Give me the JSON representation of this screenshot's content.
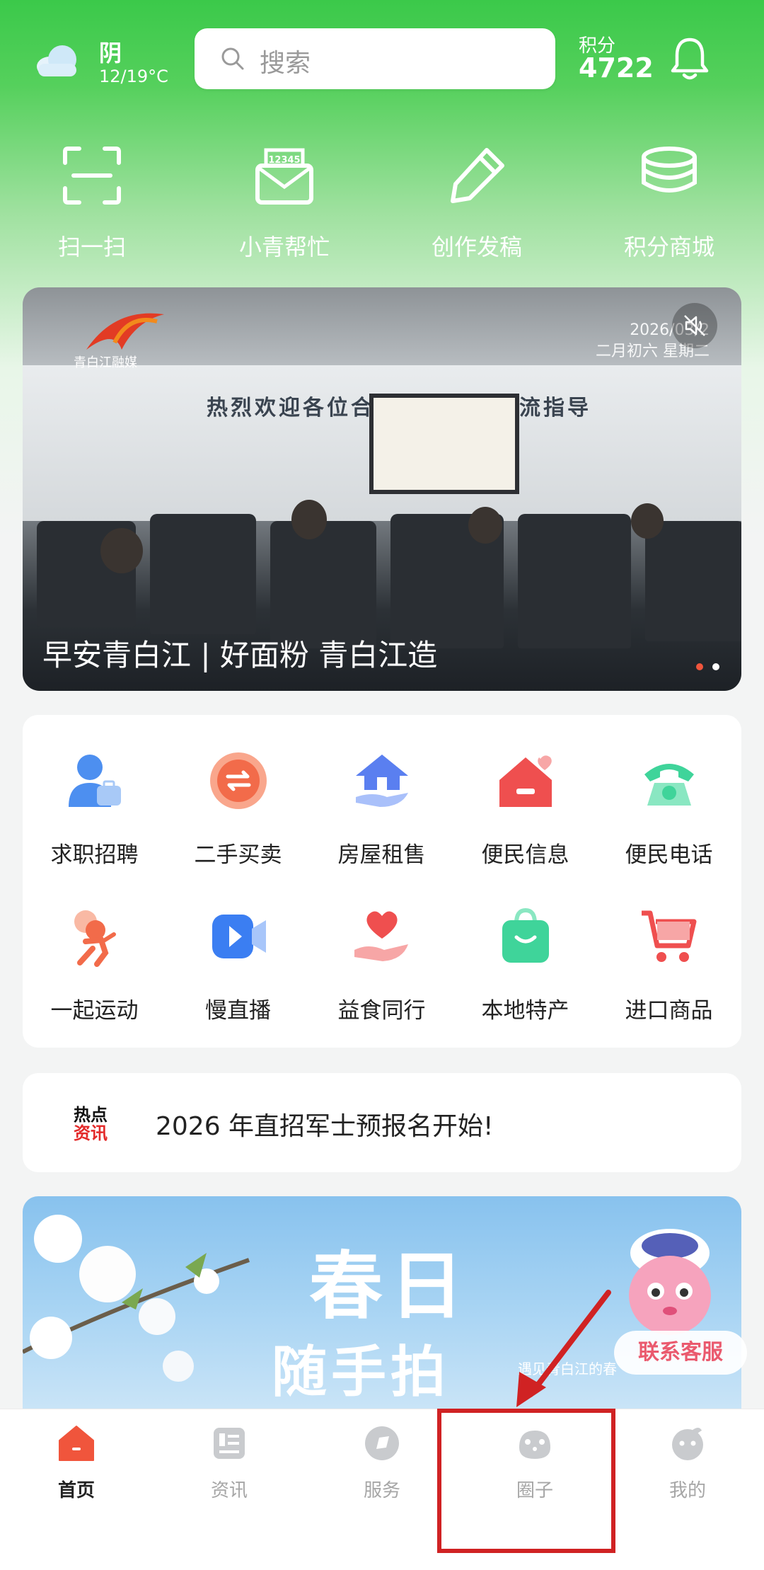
{
  "colors": {
    "accent": "#f0553c",
    "green": "#3bc94a",
    "annotation": "#d02223"
  },
  "weather": {
    "condition": "阴",
    "temp": "12/19°C",
    "icon": "cloud-icon"
  },
  "search": {
    "placeholder": "搜索"
  },
  "points": {
    "label": "积分",
    "value": "4722"
  },
  "quick_actions": [
    {
      "label": "扫一扫",
      "icon": "scan-icon"
    },
    {
      "label": "小青帮忙",
      "icon": "mail-12345-icon"
    },
    {
      "label": "创作发稿",
      "icon": "pencil-icon"
    },
    {
      "label": "积分商城",
      "icon": "coins-icon"
    }
  ],
  "banner": {
    "logo_text": "青白江融媒",
    "date": "2026/03/2",
    "lunar": "二月初六 星期二",
    "wall_text": "热烈欢迎各位合作伙伴莅临交流指导",
    "title": "早安青白江 | 好面粉 青白江造",
    "slide_count": 2,
    "active_slide": 1
  },
  "services": [
    {
      "label": "求职招聘",
      "icon": "job-person-icon"
    },
    {
      "label": "二手买卖",
      "icon": "exchange-coin-icon"
    },
    {
      "label": "房屋租售",
      "icon": "house-hand-icon"
    },
    {
      "label": "便民信息",
      "icon": "home-heart-icon"
    },
    {
      "label": "便民电话",
      "icon": "telephone-icon"
    },
    {
      "label": "一起运动",
      "icon": "runner-icon"
    },
    {
      "label": "慢直播",
      "icon": "video-camera-icon"
    },
    {
      "label": "益食同行",
      "icon": "heart-hand-icon"
    },
    {
      "label": "本地特产",
      "icon": "shopping-bag-icon"
    },
    {
      "label": "进口商品",
      "icon": "shopping-cart-icon"
    }
  ],
  "hot_news": {
    "badge_line1": "热点",
    "badge_line2": "资讯",
    "text": "2026 年直招军士预报名开始!"
  },
  "promo": {
    "title_line1": "春日",
    "title_line2": "随手拍",
    "subtitle": "遇见青白江的春"
  },
  "contact": {
    "label": "联系客服"
  },
  "bottom_nav": [
    {
      "label": "首页",
      "icon": "home-icon",
      "active": true
    },
    {
      "label": "资讯",
      "icon": "news-icon",
      "active": false
    },
    {
      "label": "服务",
      "icon": "service-icon",
      "active": false
    },
    {
      "label": "圈子",
      "icon": "circle-community-icon",
      "active": false
    },
    {
      "label": "我的",
      "icon": "profile-icon",
      "active": false
    }
  ]
}
